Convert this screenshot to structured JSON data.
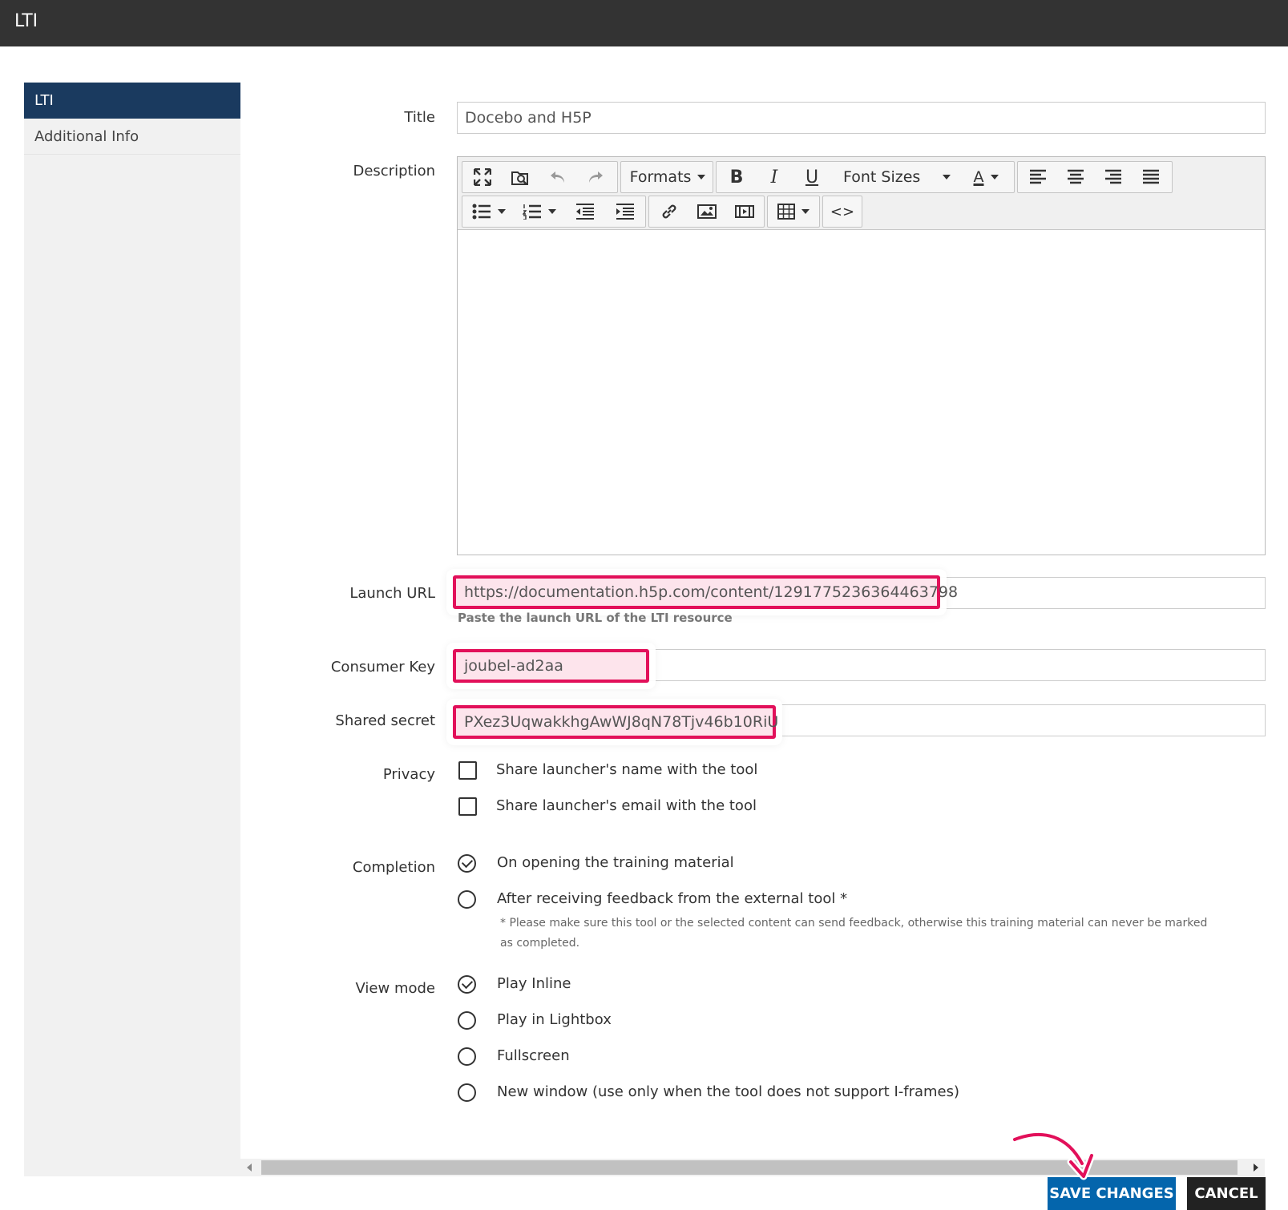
{
  "window": {
    "title": "LTI"
  },
  "sidebar": {
    "items": [
      {
        "label": "LTI",
        "active": true
      },
      {
        "label": "Additional Info",
        "active": false
      }
    ]
  },
  "form": {
    "title": {
      "label": "Title",
      "value": "Docebo and H5P"
    },
    "description": {
      "label": "Description",
      "toolbar": {
        "formats_label": "Formats",
        "bold_label": "B",
        "italic_label": "I",
        "underline_label": "U",
        "font_sizes_label": "Font Sizes",
        "text_color_label": "A",
        "code_label": "<>"
      }
    },
    "launch_url": {
      "label": "Launch URL",
      "value": "https://documentation.h5p.com/content/1291775236364463798",
      "help": "Paste the launch URL of the LTI resource"
    },
    "consumer_key": {
      "label": "Consumer Key",
      "value": "joubel-ad2aa"
    },
    "shared_secret": {
      "label": "Shared secret",
      "value": "PXez3UqwakkhgAwWJ8qN78Tjv46b10RiU"
    },
    "privacy": {
      "label": "Privacy",
      "options": [
        {
          "label": "Share launcher's name with the tool",
          "checked": false
        },
        {
          "label": "Share launcher's email with the tool",
          "checked": false
        }
      ]
    },
    "completion": {
      "label": "Completion",
      "options": [
        {
          "label": "On opening the training material",
          "selected": true
        },
        {
          "label": "After receiving feedback from the external tool *",
          "selected": false
        }
      ],
      "note": "* Please make sure this tool or the selected content can send feedback, otherwise this training material can never be marked as completed."
    },
    "view_mode": {
      "label": "View mode",
      "options": [
        {
          "label": "Play Inline",
          "selected": true
        },
        {
          "label": "Play in Lightbox",
          "selected": false
        },
        {
          "label": "Fullscreen",
          "selected": false
        },
        {
          "label": "New window (use only when the tool does not support I-frames)",
          "selected": false
        }
      ]
    }
  },
  "footer": {
    "save_label": "SAVE CHANGES",
    "cancel_label": "CANCEL"
  },
  "colors": {
    "titlebar": "#333333",
    "sidebar_active": "#1a3a5f",
    "highlight": "#e2105a",
    "save_button": "#0465ac",
    "cancel_button": "#222222"
  }
}
